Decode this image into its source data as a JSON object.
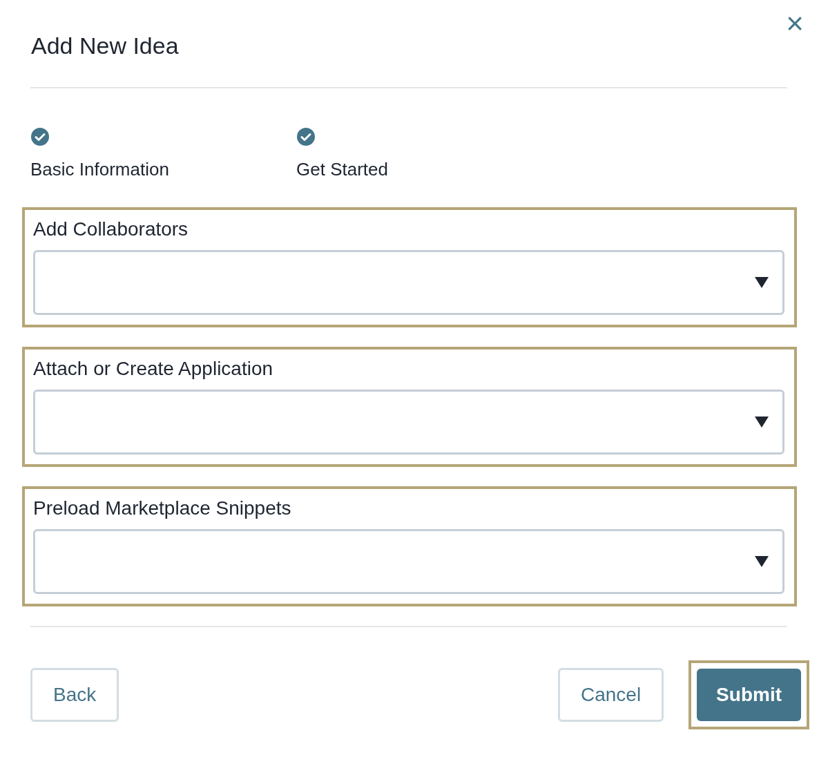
{
  "dialog": {
    "title": "Add New Idea",
    "close": "×"
  },
  "steps": [
    {
      "label": "Basic Information",
      "completed": true
    },
    {
      "label": "Get Started",
      "completed": true
    }
  ],
  "fields": [
    {
      "label": "Add Collaborators",
      "highlighted": true
    },
    {
      "label": "Attach or Create Application",
      "highlighted": true
    },
    {
      "label": "Preload Marketplace Snippets",
      "highlighted": true
    }
  ],
  "buttons": [
    {
      "label": "Back",
      "kind": "secondary",
      "highlighted": false
    },
    {
      "label": "Cancel",
      "kind": "secondary",
      "highlighted": false
    },
    {
      "label": "Submit",
      "kind": "primary",
      "highlighted": true
    }
  ]
}
